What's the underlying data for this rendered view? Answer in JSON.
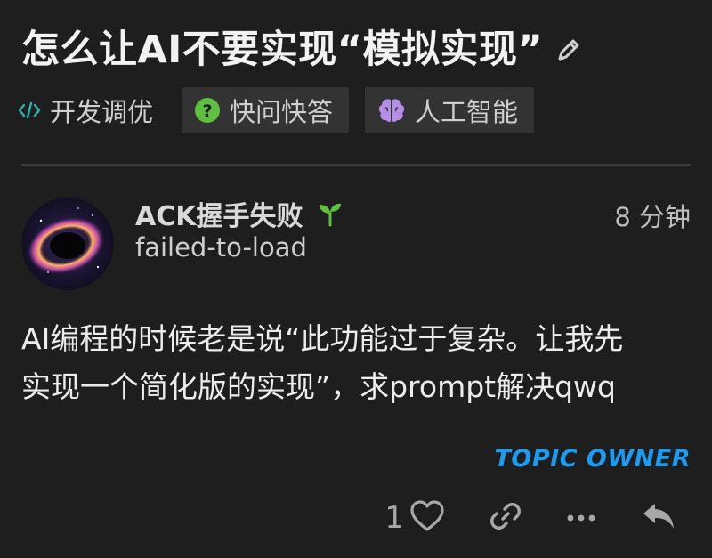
{
  "topic": {
    "title": "怎么让AI不要实现“模拟实现”",
    "edit_icon": "pencil-icon"
  },
  "tags": {
    "category": {
      "label": "开发调优",
      "icon": "code-icon",
      "color": "#2bb5a8"
    },
    "items": [
      {
        "label": "快问快答",
        "icon": "question-circle-icon",
        "color": "#5fbf3f"
      },
      {
        "label": "人工智能",
        "icon": "brain-icon",
        "color": "#b58ce6"
      }
    ]
  },
  "post": {
    "author_name": "ACK握手失败",
    "author_handle": "failed-to-load",
    "badge_icon": "sprout-icon",
    "time": "8 分钟",
    "body_lines": [
      "AI编程的时候老是说“此功能过于复杂。让我先",
      "实现一个简化版的实现”，求prompt解决qwq"
    ],
    "owner_label": "TOPIC OWNER",
    "like_count": "1"
  },
  "colors": {
    "background": "#1e1e1e",
    "accent_blue": "#1d9bf0",
    "sprout_green": "#5fbf3f"
  }
}
